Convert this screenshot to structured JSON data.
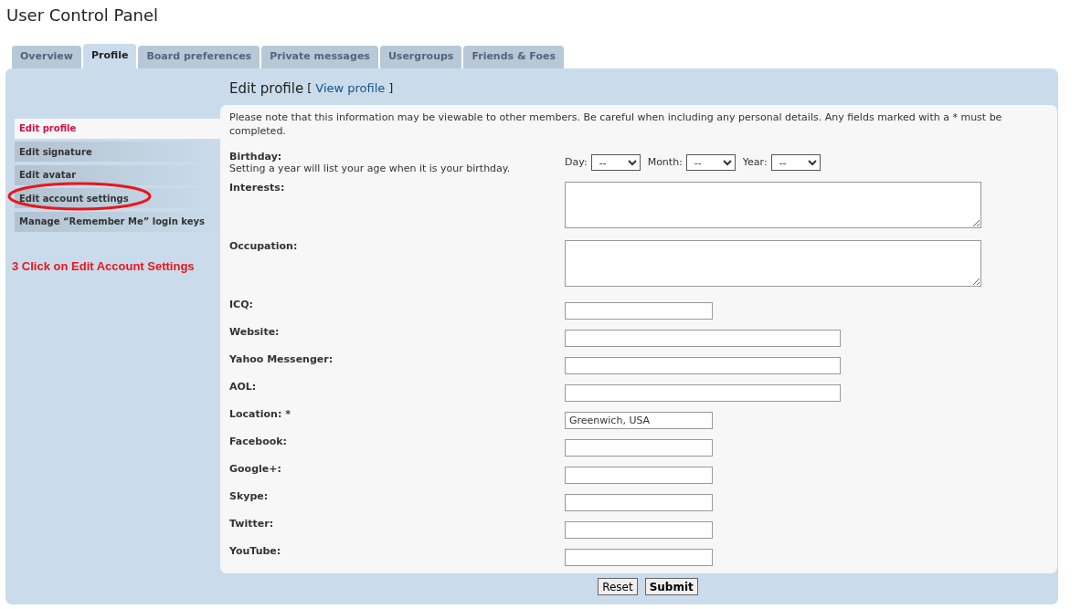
{
  "page_title": "User Control Panel",
  "tabs": [
    {
      "label": "Overview",
      "selected": false
    },
    {
      "label": "Profile",
      "selected": true
    },
    {
      "label": "Board preferences",
      "selected": false
    },
    {
      "label": "Private messages",
      "selected": false
    },
    {
      "label": "Usergroups",
      "selected": false
    },
    {
      "label": "Friends & Foes",
      "selected": false
    }
  ],
  "sidebar": {
    "items": [
      {
        "label": "Edit profile",
        "selected": true,
        "circled": false
      },
      {
        "label": "Edit signature",
        "selected": false,
        "circled": false
      },
      {
        "label": "Edit avatar",
        "selected": false,
        "circled": false
      },
      {
        "label": "Edit account settings",
        "selected": false,
        "circled": true
      },
      {
        "label": "Manage “Remember Me” login keys",
        "selected": false,
        "circled": false
      }
    ],
    "annotation": "3 Click on Edit Account Settings"
  },
  "content": {
    "heading": "Edit profile",
    "link": "View profile",
    "link_open": "[",
    "link_close": "]",
    "note": "Please note that this information may be viewable to other members. Be careful when including any personal details. Any fields marked with a * must be completed.",
    "fields": [
      {
        "kind": "birthday",
        "label": "Birthday:",
        "hint": "Setting a year will list your age when it is your birthday.",
        "selects": [
          {
            "label": "Day:",
            "value": "--"
          },
          {
            "label": "Month:",
            "value": "--"
          },
          {
            "label": "Year:",
            "value": "--"
          }
        ]
      },
      {
        "kind": "textarea",
        "label": "Interests:"
      },
      {
        "kind": "textarea",
        "label": "Occupation:"
      },
      {
        "kind": "short-text",
        "label": "ICQ:"
      },
      {
        "kind": "long-text",
        "label": "Website:"
      },
      {
        "kind": "long-text",
        "label": "Yahoo Messenger:"
      },
      {
        "kind": "long-text",
        "label": "AOL:"
      },
      {
        "kind": "short-text",
        "label": "Location: *",
        "value": "Greenwich, USA"
      },
      {
        "kind": "short-text",
        "label": "Facebook:"
      },
      {
        "kind": "short-text",
        "label": "Google+:"
      },
      {
        "kind": "short-text",
        "label": "Skype:"
      },
      {
        "kind": "short-text",
        "label": "Twitter:"
      },
      {
        "kind": "short-text",
        "label": "YouTube:"
      }
    ]
  },
  "buttons": [
    {
      "label": "Reset",
      "kind": "reset"
    },
    {
      "label": "Submit",
      "kind": "submit"
    }
  ]
}
